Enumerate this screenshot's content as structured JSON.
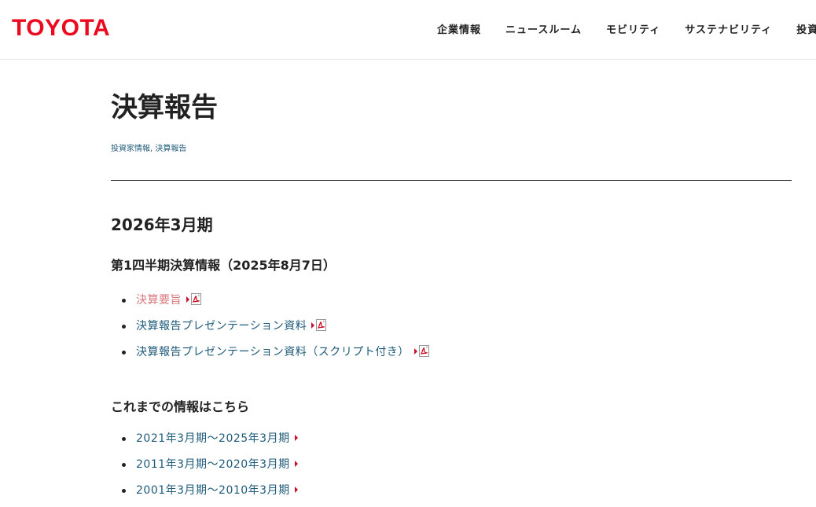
{
  "header": {
    "logo": "TOYOTA",
    "nav": [
      "企業情報",
      "ニュースルーム",
      "モビリティ",
      "サステナビリティ",
      "投資"
    ]
  },
  "page": {
    "title": "決算報告",
    "breadcrumb": [
      "投資家情報",
      "決算報告"
    ],
    "breadcrumb_sep": ", "
  },
  "fiscal_year": {
    "heading": "2026年3月期",
    "quarter_heading": "第1四半期決算情報（2025年8月7日）",
    "documents": [
      {
        "label": "決算要旨",
        "visited": true
      },
      {
        "label": "決算報告プレゼンテーション資料",
        "visited": false
      },
      {
        "label": "決算報告プレゼンテーション資料（スクリプト付き）",
        "visited": false
      }
    ]
  },
  "past": {
    "heading": "これまでの情報はこちら",
    "links": [
      "2021年3月期〜2025年3月期",
      "2011年3月期〜2020年3月期",
      "2001年3月期〜2010年3月期"
    ]
  },
  "colors": {
    "brand_red": "#eb0a1e",
    "link": "#1e5a7a",
    "visited_link": "#d9767c"
  },
  "icons": {
    "arrow": "triangle-right-icon",
    "document": "pdf-icon"
  }
}
